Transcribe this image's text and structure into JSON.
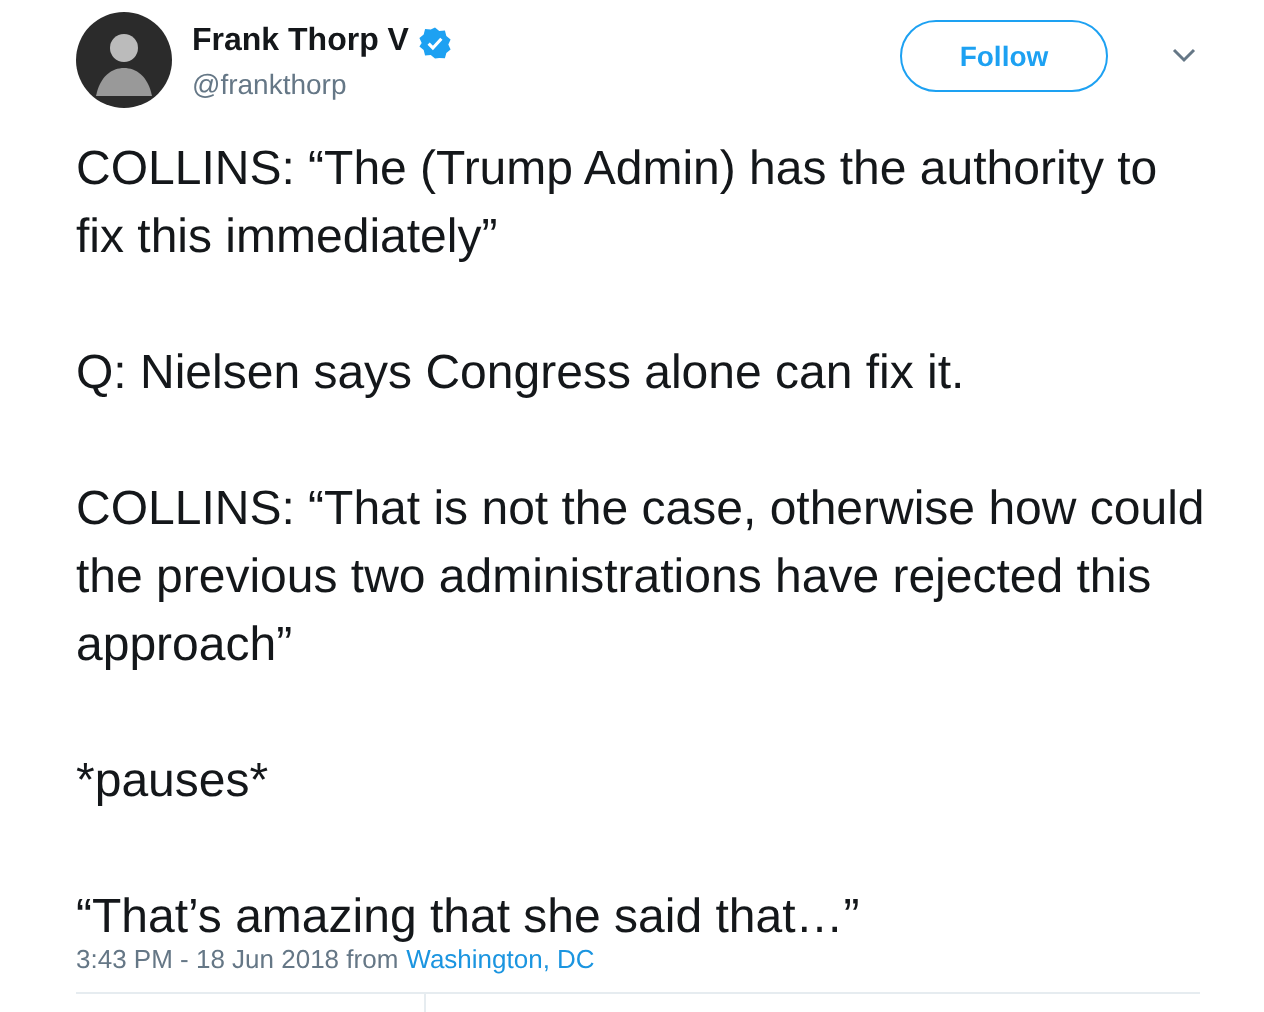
{
  "author": {
    "name": "Frank Thorp V",
    "handle": "@frankthorp",
    "verified": true
  },
  "follow_button": {
    "label": "Follow"
  },
  "paragraphs": [
    "COLLINS: “The (Trump Admin) has the authority to fix this immediately”",
    "Q: Nielsen says Congress alone can fix it.",
    "COLLINS: “That is not the case, otherwise how could the previous two administrations have rejected this approach”",
    "*pauses*",
    "“That’s amazing that she said that…”"
  ],
  "timestamp": "3:43 PM - 18 Jun 2018 from",
  "location": "Washington, DC"
}
